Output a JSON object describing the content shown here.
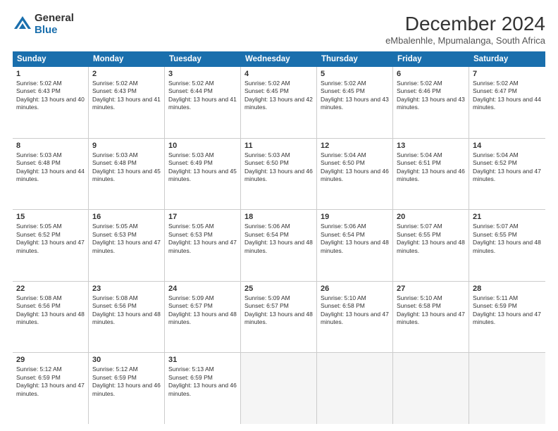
{
  "logo": {
    "general": "General",
    "blue": "Blue"
  },
  "title": "December 2024",
  "subtitle": "eMbalenhle, Mpumalanga, South Africa",
  "header_days": [
    "Sunday",
    "Monday",
    "Tuesday",
    "Wednesday",
    "Thursday",
    "Friday",
    "Saturday"
  ],
  "weeks": [
    [
      {
        "day": "1",
        "sunrise": "5:02 AM",
        "sunset": "6:43 PM",
        "daylight": "13 hours and 40 minutes."
      },
      {
        "day": "2",
        "sunrise": "5:02 AM",
        "sunset": "6:43 PM",
        "daylight": "13 hours and 41 minutes."
      },
      {
        "day": "3",
        "sunrise": "5:02 AM",
        "sunset": "6:44 PM",
        "daylight": "13 hours and 41 minutes."
      },
      {
        "day": "4",
        "sunrise": "5:02 AM",
        "sunset": "6:45 PM",
        "daylight": "13 hours and 42 minutes."
      },
      {
        "day": "5",
        "sunrise": "5:02 AM",
        "sunset": "6:45 PM",
        "daylight": "13 hours and 43 minutes."
      },
      {
        "day": "6",
        "sunrise": "5:02 AM",
        "sunset": "6:46 PM",
        "daylight": "13 hours and 43 minutes."
      },
      {
        "day": "7",
        "sunrise": "5:02 AM",
        "sunset": "6:47 PM",
        "daylight": "13 hours and 44 minutes."
      }
    ],
    [
      {
        "day": "8",
        "sunrise": "5:03 AM",
        "sunset": "6:48 PM",
        "daylight": "13 hours and 44 minutes."
      },
      {
        "day": "9",
        "sunrise": "5:03 AM",
        "sunset": "6:48 PM",
        "daylight": "13 hours and 45 minutes."
      },
      {
        "day": "10",
        "sunrise": "5:03 AM",
        "sunset": "6:49 PM",
        "daylight": "13 hours and 45 minutes."
      },
      {
        "day": "11",
        "sunrise": "5:03 AM",
        "sunset": "6:50 PM",
        "daylight": "13 hours and 46 minutes."
      },
      {
        "day": "12",
        "sunrise": "5:04 AM",
        "sunset": "6:50 PM",
        "daylight": "13 hours and 46 minutes."
      },
      {
        "day": "13",
        "sunrise": "5:04 AM",
        "sunset": "6:51 PM",
        "daylight": "13 hours and 46 minutes."
      },
      {
        "day": "14",
        "sunrise": "5:04 AM",
        "sunset": "6:52 PM",
        "daylight": "13 hours and 47 minutes."
      }
    ],
    [
      {
        "day": "15",
        "sunrise": "5:05 AM",
        "sunset": "6:52 PM",
        "daylight": "13 hours and 47 minutes."
      },
      {
        "day": "16",
        "sunrise": "5:05 AM",
        "sunset": "6:53 PM",
        "daylight": "13 hours and 47 minutes."
      },
      {
        "day": "17",
        "sunrise": "5:05 AM",
        "sunset": "6:53 PM",
        "daylight": "13 hours and 47 minutes."
      },
      {
        "day": "18",
        "sunrise": "5:06 AM",
        "sunset": "6:54 PM",
        "daylight": "13 hours and 48 minutes."
      },
      {
        "day": "19",
        "sunrise": "5:06 AM",
        "sunset": "6:54 PM",
        "daylight": "13 hours and 48 minutes."
      },
      {
        "day": "20",
        "sunrise": "5:07 AM",
        "sunset": "6:55 PM",
        "daylight": "13 hours and 48 minutes."
      },
      {
        "day": "21",
        "sunrise": "5:07 AM",
        "sunset": "6:55 PM",
        "daylight": "13 hours and 48 minutes."
      }
    ],
    [
      {
        "day": "22",
        "sunrise": "5:08 AM",
        "sunset": "6:56 PM",
        "daylight": "13 hours and 48 minutes."
      },
      {
        "day": "23",
        "sunrise": "5:08 AM",
        "sunset": "6:56 PM",
        "daylight": "13 hours and 48 minutes."
      },
      {
        "day": "24",
        "sunrise": "5:09 AM",
        "sunset": "6:57 PM",
        "daylight": "13 hours and 48 minutes."
      },
      {
        "day": "25",
        "sunrise": "5:09 AM",
        "sunset": "6:57 PM",
        "daylight": "13 hours and 48 minutes."
      },
      {
        "day": "26",
        "sunrise": "5:10 AM",
        "sunset": "6:58 PM",
        "daylight": "13 hours and 47 minutes."
      },
      {
        "day": "27",
        "sunrise": "5:10 AM",
        "sunset": "6:58 PM",
        "daylight": "13 hours and 47 minutes."
      },
      {
        "day": "28",
        "sunrise": "5:11 AM",
        "sunset": "6:59 PM",
        "daylight": "13 hours and 47 minutes."
      }
    ],
    [
      {
        "day": "29",
        "sunrise": "5:12 AM",
        "sunset": "6:59 PM",
        "daylight": "13 hours and 47 minutes."
      },
      {
        "day": "30",
        "sunrise": "5:12 AM",
        "sunset": "6:59 PM",
        "daylight": "13 hours and 46 minutes."
      },
      {
        "day": "31",
        "sunrise": "5:13 AM",
        "sunset": "6:59 PM",
        "daylight": "13 hours and 46 minutes."
      },
      null,
      null,
      null,
      null
    ]
  ]
}
